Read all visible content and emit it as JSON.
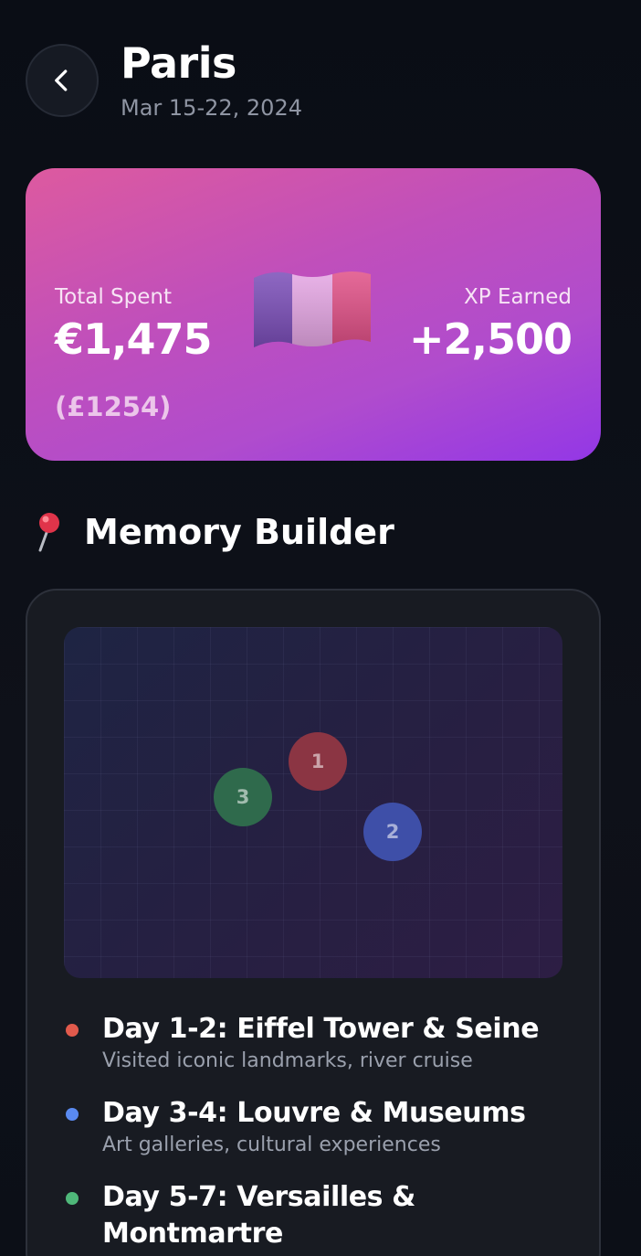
{
  "header": {
    "title": "Paris",
    "dates": "Mar 15-22, 2024",
    "back_icon": "chevron-left-icon"
  },
  "summary": {
    "spent_label": "Total Spent",
    "spent_value": "€1,475",
    "spent_secondary": "(£1254)",
    "xp_label": "XP Earned",
    "xp_value": "+2,500",
    "flag_icon": "france-flag-icon",
    "gradient_colors": [
      "#dd5a9f",
      "#b04ccd",
      "#9337e6"
    ]
  },
  "memory": {
    "section_icon": "map-pin-icon",
    "section_title": "Memory Builder",
    "pins": [
      {
        "label": "1",
        "color": "#8b3543"
      },
      {
        "label": "2",
        "color": "#3e4fa8"
      },
      {
        "label": "3",
        "color": "#2f6a4c"
      }
    ],
    "items": [
      {
        "title": "Day 1-2: Eiffel Tower & Seine",
        "subtitle": "Visited iconic landmarks, river cruise",
        "dot_color": "#e15a4c"
      },
      {
        "title": "Day 3-4: Louvre & Museums",
        "subtitle": "Art galleries, cultural experiences",
        "dot_color": "#5a8af0"
      },
      {
        "title": "Day 5-7: Versailles & Montmartre",
        "subtitle": "",
        "dot_color": "#4fb87a"
      }
    ]
  }
}
